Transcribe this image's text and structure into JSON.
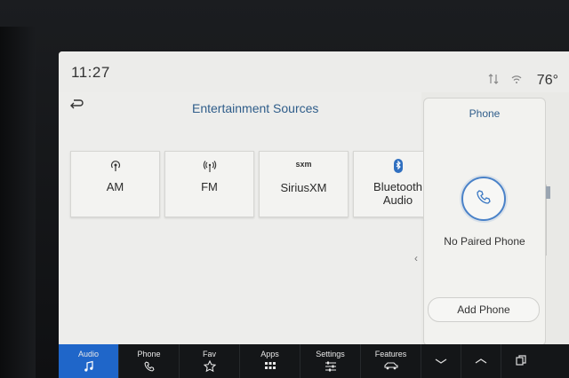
{
  "status": {
    "time": "11:27",
    "temperature": "76°"
  },
  "main": {
    "title": "Entertainment Sources"
  },
  "sources": [
    {
      "label": "AM",
      "icon": "am-antenna-icon"
    },
    {
      "label": "FM",
      "icon": "fm-antenna-icon"
    },
    {
      "label": "SiriusXM",
      "icon": "siriusxm-logo-icon",
      "icon_text": "sxm"
    },
    {
      "label": "Bluetooth\nAudio",
      "icon": "bluetooth-icon"
    }
  ],
  "phone": {
    "title": "Phone",
    "status": "No Paired Phone",
    "add_label": "Add Phone"
  },
  "navbar": {
    "items": [
      {
        "label": "Audio",
        "icon": "music-note-icon",
        "active": true
      },
      {
        "label": "Phone",
        "icon": "phone-icon"
      },
      {
        "label": "Fav",
        "icon": "star-icon"
      },
      {
        "label": "Apps",
        "icon": "apps-grid-icon"
      },
      {
        "label": "Settings",
        "icon": "sliders-icon"
      },
      {
        "label": "Features",
        "icon": "car-icon"
      }
    ]
  },
  "colors": {
    "accent": "#1f66c9",
    "title_blue": "#2f5d8a"
  }
}
